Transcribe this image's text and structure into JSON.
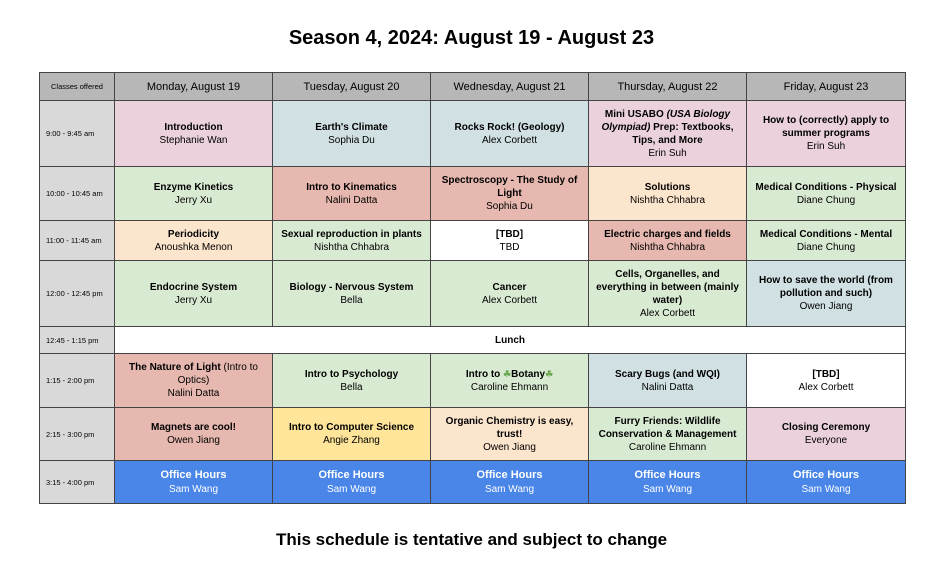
{
  "title": "Season 4, 2024: August 19 - August 23",
  "footer": "This schedule is tentative and subject to change",
  "header": {
    "corner": "Classes offered",
    "days": [
      "Monday, August 19",
      "Tuesday, August 20",
      "Wednesday, August 21",
      "Thursday, August 22",
      "Friday, August 23"
    ]
  },
  "colors": {
    "pink": "#ead1dc",
    "blue": "#d0e0e3",
    "green": "#d9ead3",
    "peach": "#fce5cd",
    "red": "#e6b8af",
    "yellow": "#ffe599",
    "office": "#4a86e8",
    "header": "#b7b7b7",
    "time": "#d9d9d9"
  },
  "rows": [
    {
      "time": "9:00 - 9:45 am",
      "cells": [
        {
          "title": "Introduction",
          "person": "Stephanie Wan",
          "color": "pink"
        },
        {
          "title": "Earth's Climate",
          "person": "Sophia Du",
          "color": "blue"
        },
        {
          "title": "Rocks Rock! (Geology)",
          "person": "Alex Corbett",
          "color": "blue"
        },
        {
          "title": "Mini USABO ",
          "title_italic": "(USA Biology Olympiad)",
          "title_rest": " Prep: Textbooks, Tips, and More",
          "person": "Erin Suh",
          "color": "pink"
        },
        {
          "title": "How to (correctly) apply to summer programs",
          "person": "Erin Suh",
          "color": "pink"
        }
      ]
    },
    {
      "time": "10:00 - 10:45 am",
      "cells": [
        {
          "title": "Enzyme Kinetics",
          "person": "Jerry Xu",
          "color": "green"
        },
        {
          "title": "Intro to Kinematics",
          "person": "Nalini Datta",
          "color": "red"
        },
        {
          "title": "Spectroscopy - The Study of Light",
          "person": "Sophia Du",
          "color": "red"
        },
        {
          "title": "Solutions",
          "person": "Nishtha Chhabra",
          "color": "peach"
        },
        {
          "title": "Medical Conditions - Physical",
          "person": "Diane Chung",
          "color": "green"
        }
      ]
    },
    {
      "time": "11:00 - 11:45 am",
      "cells": [
        {
          "title": "Periodicity",
          "person": "Anoushka Menon",
          "color": "peach"
        },
        {
          "title": "Sexual reproduction in plants",
          "person": "Nishtha Chhabra",
          "color": "green"
        },
        {
          "title": "[TBD]",
          "person": "TBD",
          "color": "white"
        },
        {
          "title": "Electric charges and fields",
          "person": "Nishtha Chhabra",
          "color": "red"
        },
        {
          "title": "Medical Conditions - Mental",
          "person": "Diane Chung",
          "color": "green"
        }
      ]
    },
    {
      "time": "12:00 - 12:45 pm",
      "cells": [
        {
          "title": "Endocrine System",
          "person": "Jerry Xu",
          "color": "green"
        },
        {
          "title": "Biology - Nervous System",
          "person": "Bella",
          "color": "green"
        },
        {
          "title": "Cancer",
          "person": "Alex Corbett",
          "color": "green"
        },
        {
          "title": "Cells, Organelles, and everything in between (mainly water)",
          "person": "Alex Corbett",
          "color": "green"
        },
        {
          "title": "How to save the world (from pollution and such)",
          "person": "Owen Jiang",
          "color": "blue"
        }
      ]
    },
    {
      "time": "12:45 - 1:15 pm",
      "lunch": "Lunch"
    },
    {
      "time": "1:15 - 2:00 pm",
      "cells": [
        {
          "title": "The Nature of Light ",
          "title_rest": "(Intro to Optics)",
          "person": "Nalini Datta",
          "color": "red"
        },
        {
          "title": "Intro to Psychology",
          "person": "Bella",
          "color": "green"
        },
        {
          "title": "Intro to ",
          "icon1": "leaf-icon",
          "title_rest": "Botany",
          "icon2": "leaf-icon",
          "person": "Caroline Ehmann",
          "color": "green"
        },
        {
          "title": "Scary Bugs (and WQI)",
          "person": "Nalini Datta",
          "color": "blue"
        },
        {
          "title": "[TBD]",
          "person": "Alex Corbett",
          "color": "white"
        }
      ]
    },
    {
      "time": "2:15 - 3:00 pm",
      "cells": [
        {
          "title": "Magnets are cool!",
          "person": "Owen Jiang",
          "color": "red"
        },
        {
          "title": "Intro to Computer Science",
          "person": "Angie Zhang",
          "color": "yellow"
        },
        {
          "title": "Organic Chemistry is easy, trust!",
          "person": "Owen Jiang",
          "color": "peach"
        },
        {
          "title": "Furry Friends: Wildlife Conservation & Management",
          "person": "Caroline Ehmann",
          "color": "green"
        },
        {
          "title": "Closing Ceremony",
          "person": "Everyone",
          "color": "pink"
        }
      ]
    },
    {
      "time": "3:15 - 4:00 pm",
      "cells": [
        {
          "title": "Office Hours",
          "person": "Sam Wang",
          "color": "office"
        },
        {
          "title": "Office Hours",
          "person": "Sam Wang",
          "color": "office"
        },
        {
          "title": "Office Hours",
          "person": "Sam Wang",
          "color": "office"
        },
        {
          "title": "Office Hours",
          "person": "Sam Wang",
          "color": "office"
        },
        {
          "title": "Office Hours",
          "person": "Sam Wang",
          "color": "office"
        }
      ]
    }
  ]
}
